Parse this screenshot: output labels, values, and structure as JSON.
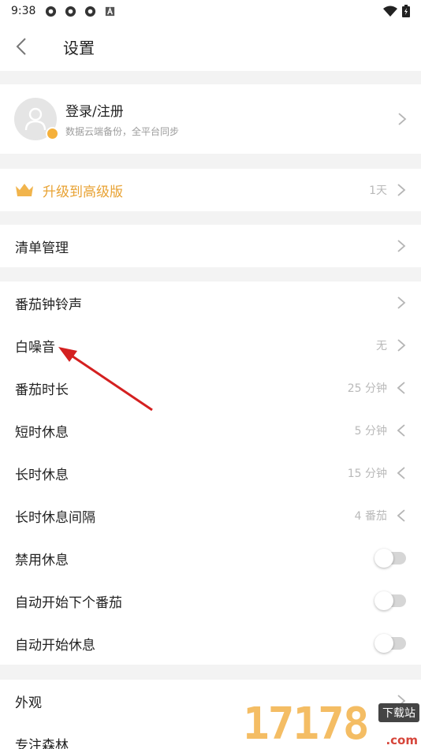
{
  "status_bar": {
    "time": "9:38",
    "icons": [
      "app-notification-icon",
      "app-notification-icon",
      "app-notification-icon",
      "a-box-icon"
    ],
    "right_icons": [
      "wifi-icon",
      "battery-charging-icon"
    ]
  },
  "header": {
    "title": "设置"
  },
  "account": {
    "name": "登录/注册",
    "subtitle": "数据云端备份，全平台同步"
  },
  "premium": {
    "label": "升级到高级版",
    "value": "1天",
    "accent": "#e8a233"
  },
  "lists": {
    "label": "清单管理"
  },
  "pomodoro": {
    "rows": [
      {
        "label": "番茄钟铃声",
        "value": ""
      },
      {
        "label": "白噪音",
        "value": "无"
      },
      {
        "label": "番茄时长",
        "value": "25 分钟"
      },
      {
        "label": "短时休息",
        "value": "5 分钟"
      },
      {
        "label": "长时休息",
        "value": "15 分钟"
      },
      {
        "label": "长时休息间隔",
        "value": "4 番茄"
      }
    ],
    "toggles": [
      {
        "label": "禁用休息",
        "on": false
      },
      {
        "label": "自动开始下个番茄",
        "on": false
      },
      {
        "label": "自动开始休息",
        "on": false
      }
    ]
  },
  "other": {
    "rows": [
      {
        "label": "外观"
      },
      {
        "label": "专注森林"
      }
    ]
  },
  "watermark": {
    "digits": "17178",
    "badge": "下载站",
    "suffix": ".com"
  },
  "colors": {
    "background": "#f3f3f3",
    "card": "#ffffff",
    "annotation_arrow": "#d42020"
  }
}
